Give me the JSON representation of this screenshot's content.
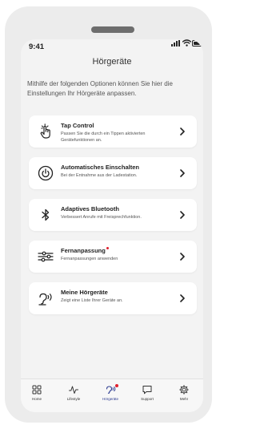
{
  "status_bar": {
    "time": "9:41"
  },
  "header": {
    "title": "Hörgeräte"
  },
  "intro": {
    "text": "Mithilfe der folgenden Optionen können Sie hier die Einstellungen Ihr Hörgeräte anpassen."
  },
  "cards": [
    {
      "title": "Tap Control",
      "description": "Passen Sie die durch ein Tippen aktivierten Gerätefunktionen an.",
      "icon": "tap-hand-icon",
      "has_badge": false
    },
    {
      "title": "Automatisches Einschalten",
      "description": "Bei der Entnahme aus der Ladestation.",
      "icon": "power-icon",
      "has_badge": false
    },
    {
      "title": "Adaptives Bluetooth",
      "description": "Verbessert Anrufe mit Freisprechfunktion.",
      "icon": "bluetooth-icon",
      "has_badge": false
    },
    {
      "title": "Fernanpassung",
      "description": "Fernanpassungen anwenden",
      "icon": "sliders-icon",
      "has_badge": true
    },
    {
      "title": "Meine Hörgeräte",
      "description": "Zeigt eine Liste Ihrer Geräte an.",
      "icon": "hearing-aid-icon",
      "has_badge": false
    }
  ],
  "tabbar": {
    "tabs": [
      {
        "label": "Home",
        "icon": "grid-icon",
        "active": false
      },
      {
        "label": "Lifestyle",
        "icon": "activity-icon",
        "active": false
      },
      {
        "label": "Hörgeräte",
        "icon": "hearing-aid-icon",
        "active": true,
        "has_badge": true
      },
      {
        "label": "Support",
        "icon": "chat-icon",
        "active": false
      },
      {
        "label": "Mehr",
        "icon": "gear-icon",
        "active": false
      }
    ]
  },
  "colors": {
    "accent": "#2b3a8f",
    "badge": "#e0202e",
    "background": "#f3f3f3",
    "card": "#ffffff"
  }
}
